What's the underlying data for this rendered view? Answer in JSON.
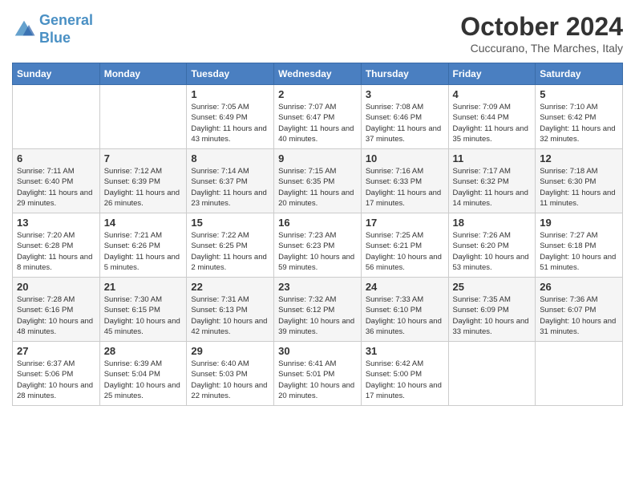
{
  "header": {
    "logo_line1": "General",
    "logo_line2": "Blue",
    "month": "October 2024",
    "location": "Cuccurano, The Marches, Italy"
  },
  "days_of_week": [
    "Sunday",
    "Monday",
    "Tuesday",
    "Wednesday",
    "Thursday",
    "Friday",
    "Saturday"
  ],
  "weeks": [
    [
      {
        "day": "",
        "info": ""
      },
      {
        "day": "",
        "info": ""
      },
      {
        "day": "1",
        "info": "Sunrise: 7:05 AM\nSunset: 6:49 PM\nDaylight: 11 hours and 43 minutes."
      },
      {
        "day": "2",
        "info": "Sunrise: 7:07 AM\nSunset: 6:47 PM\nDaylight: 11 hours and 40 minutes."
      },
      {
        "day": "3",
        "info": "Sunrise: 7:08 AM\nSunset: 6:46 PM\nDaylight: 11 hours and 37 minutes."
      },
      {
        "day": "4",
        "info": "Sunrise: 7:09 AM\nSunset: 6:44 PM\nDaylight: 11 hours and 35 minutes."
      },
      {
        "day": "5",
        "info": "Sunrise: 7:10 AM\nSunset: 6:42 PM\nDaylight: 11 hours and 32 minutes."
      }
    ],
    [
      {
        "day": "6",
        "info": "Sunrise: 7:11 AM\nSunset: 6:40 PM\nDaylight: 11 hours and 29 minutes."
      },
      {
        "day": "7",
        "info": "Sunrise: 7:12 AM\nSunset: 6:39 PM\nDaylight: 11 hours and 26 minutes."
      },
      {
        "day": "8",
        "info": "Sunrise: 7:14 AM\nSunset: 6:37 PM\nDaylight: 11 hours and 23 minutes."
      },
      {
        "day": "9",
        "info": "Sunrise: 7:15 AM\nSunset: 6:35 PM\nDaylight: 11 hours and 20 minutes."
      },
      {
        "day": "10",
        "info": "Sunrise: 7:16 AM\nSunset: 6:33 PM\nDaylight: 11 hours and 17 minutes."
      },
      {
        "day": "11",
        "info": "Sunrise: 7:17 AM\nSunset: 6:32 PM\nDaylight: 11 hours and 14 minutes."
      },
      {
        "day": "12",
        "info": "Sunrise: 7:18 AM\nSunset: 6:30 PM\nDaylight: 11 hours and 11 minutes."
      }
    ],
    [
      {
        "day": "13",
        "info": "Sunrise: 7:20 AM\nSunset: 6:28 PM\nDaylight: 11 hours and 8 minutes."
      },
      {
        "day": "14",
        "info": "Sunrise: 7:21 AM\nSunset: 6:26 PM\nDaylight: 11 hours and 5 minutes."
      },
      {
        "day": "15",
        "info": "Sunrise: 7:22 AM\nSunset: 6:25 PM\nDaylight: 11 hours and 2 minutes."
      },
      {
        "day": "16",
        "info": "Sunrise: 7:23 AM\nSunset: 6:23 PM\nDaylight: 10 hours and 59 minutes."
      },
      {
        "day": "17",
        "info": "Sunrise: 7:25 AM\nSunset: 6:21 PM\nDaylight: 10 hours and 56 minutes."
      },
      {
        "day": "18",
        "info": "Sunrise: 7:26 AM\nSunset: 6:20 PM\nDaylight: 10 hours and 53 minutes."
      },
      {
        "day": "19",
        "info": "Sunrise: 7:27 AM\nSunset: 6:18 PM\nDaylight: 10 hours and 51 minutes."
      }
    ],
    [
      {
        "day": "20",
        "info": "Sunrise: 7:28 AM\nSunset: 6:16 PM\nDaylight: 10 hours and 48 minutes."
      },
      {
        "day": "21",
        "info": "Sunrise: 7:30 AM\nSunset: 6:15 PM\nDaylight: 10 hours and 45 minutes."
      },
      {
        "day": "22",
        "info": "Sunrise: 7:31 AM\nSunset: 6:13 PM\nDaylight: 10 hours and 42 minutes."
      },
      {
        "day": "23",
        "info": "Sunrise: 7:32 AM\nSunset: 6:12 PM\nDaylight: 10 hours and 39 minutes."
      },
      {
        "day": "24",
        "info": "Sunrise: 7:33 AM\nSunset: 6:10 PM\nDaylight: 10 hours and 36 minutes."
      },
      {
        "day": "25",
        "info": "Sunrise: 7:35 AM\nSunset: 6:09 PM\nDaylight: 10 hours and 33 minutes."
      },
      {
        "day": "26",
        "info": "Sunrise: 7:36 AM\nSunset: 6:07 PM\nDaylight: 10 hours and 31 minutes."
      }
    ],
    [
      {
        "day": "27",
        "info": "Sunrise: 6:37 AM\nSunset: 5:06 PM\nDaylight: 10 hours and 28 minutes."
      },
      {
        "day": "28",
        "info": "Sunrise: 6:39 AM\nSunset: 5:04 PM\nDaylight: 10 hours and 25 minutes."
      },
      {
        "day": "29",
        "info": "Sunrise: 6:40 AM\nSunset: 5:03 PM\nDaylight: 10 hours and 22 minutes."
      },
      {
        "day": "30",
        "info": "Sunrise: 6:41 AM\nSunset: 5:01 PM\nDaylight: 10 hours and 20 minutes."
      },
      {
        "day": "31",
        "info": "Sunrise: 6:42 AM\nSunset: 5:00 PM\nDaylight: 10 hours and 17 minutes."
      },
      {
        "day": "",
        "info": ""
      },
      {
        "day": "",
        "info": ""
      }
    ]
  ]
}
